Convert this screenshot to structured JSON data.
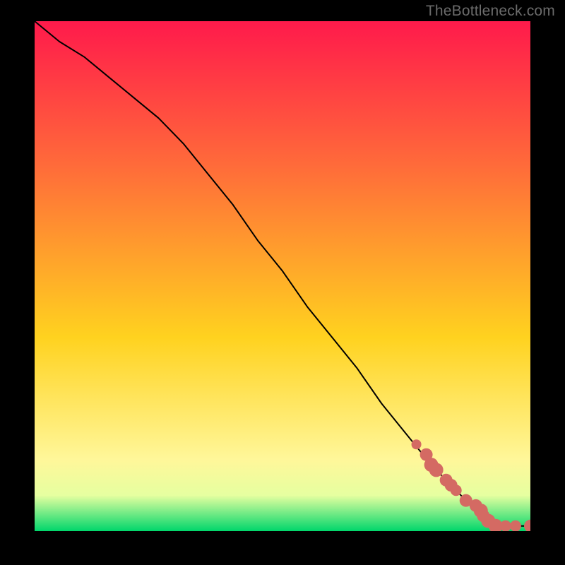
{
  "watermark": "TheBottleneck.com",
  "colors": {
    "grad_top": "#ff1a4b",
    "grad_mid1": "#ff6a3a",
    "grad_mid2": "#ffd21f",
    "grad_mid3": "#fff79a",
    "grad_mid4": "#e6ffa0",
    "grad_bottom": "#00d66b",
    "line": "#000000",
    "marker_fill": "#d46a63",
    "marker_stroke": "#d46a63",
    "bg": "#000000"
  },
  "chart_data": {
    "type": "line",
    "title": "",
    "xlabel": "",
    "ylabel": "",
    "xlim": [
      0,
      100
    ],
    "ylim": [
      0,
      100
    ],
    "grid": false,
    "series": [
      {
        "name": "curve",
        "x": [
          0,
          5,
          10,
          15,
          20,
          25,
          30,
          35,
          40,
          45,
          50,
          55,
          60,
          65,
          70,
          75,
          80,
          83,
          85,
          87,
          89,
          90,
          91,
          92,
          93,
          95,
          97,
          100
        ],
        "y": [
          100,
          96,
          93,
          89,
          85,
          81,
          76,
          70,
          64,
          57,
          51,
          44,
          38,
          32,
          25,
          19,
          13,
          10,
          8,
          6,
          5,
          4,
          3,
          2,
          1,
          1,
          1,
          1
        ]
      }
    ],
    "markers": {
      "name": "highlighted-points",
      "x": [
        77,
        79,
        80,
        81,
        83,
        84,
        85,
        87,
        89,
        90,
        90.5,
        91.5,
        93,
        95,
        97,
        100
      ],
      "y": [
        17,
        15,
        13,
        12,
        10,
        9,
        8,
        6,
        5,
        4,
        3,
        2,
        1,
        1,
        1,
        1
      ],
      "size": [
        7,
        9,
        10,
        10,
        9,
        9,
        8,
        9,
        9,
        10,
        9,
        10,
        10,
        8,
        8,
        9
      ]
    }
  }
}
